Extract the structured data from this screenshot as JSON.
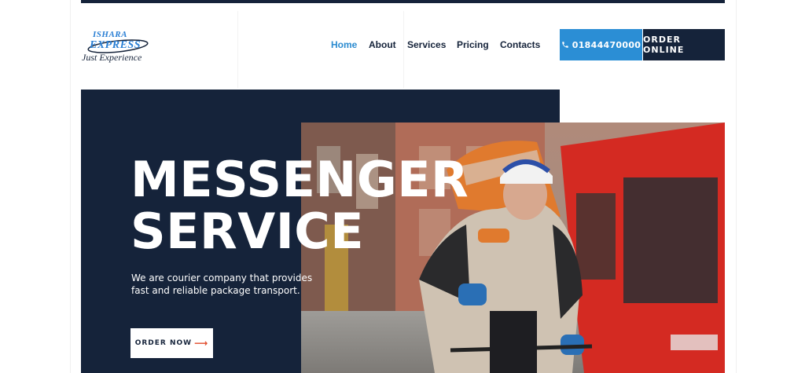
{
  "logo": {
    "line1": "ISHARA",
    "line2": "EXPRESS",
    "tagline": "Just Experience"
  },
  "nav": {
    "items": [
      {
        "label": "Home",
        "active": true
      },
      {
        "label": "About",
        "active": false
      },
      {
        "label": "Services",
        "active": false
      },
      {
        "label": "Pricing",
        "active": false
      },
      {
        "label": "Contacts",
        "active": false
      }
    ]
  },
  "header": {
    "phone_icon": "phone-icon",
    "phone": "01844470000",
    "order_label": "ORDER ONLINE"
  },
  "hero": {
    "title_line1": "MESSENGER",
    "title_line2": "SERVICE",
    "subtitle": "We are courier company that provides fast and reliable package transport.",
    "button_label": "ORDER NOW",
    "button_icon": "arrow-right-icon"
  },
  "colors": {
    "navy": "#15233a",
    "accent_blue": "#2b8ed5",
    "arrow_red": "#e04a2a"
  }
}
